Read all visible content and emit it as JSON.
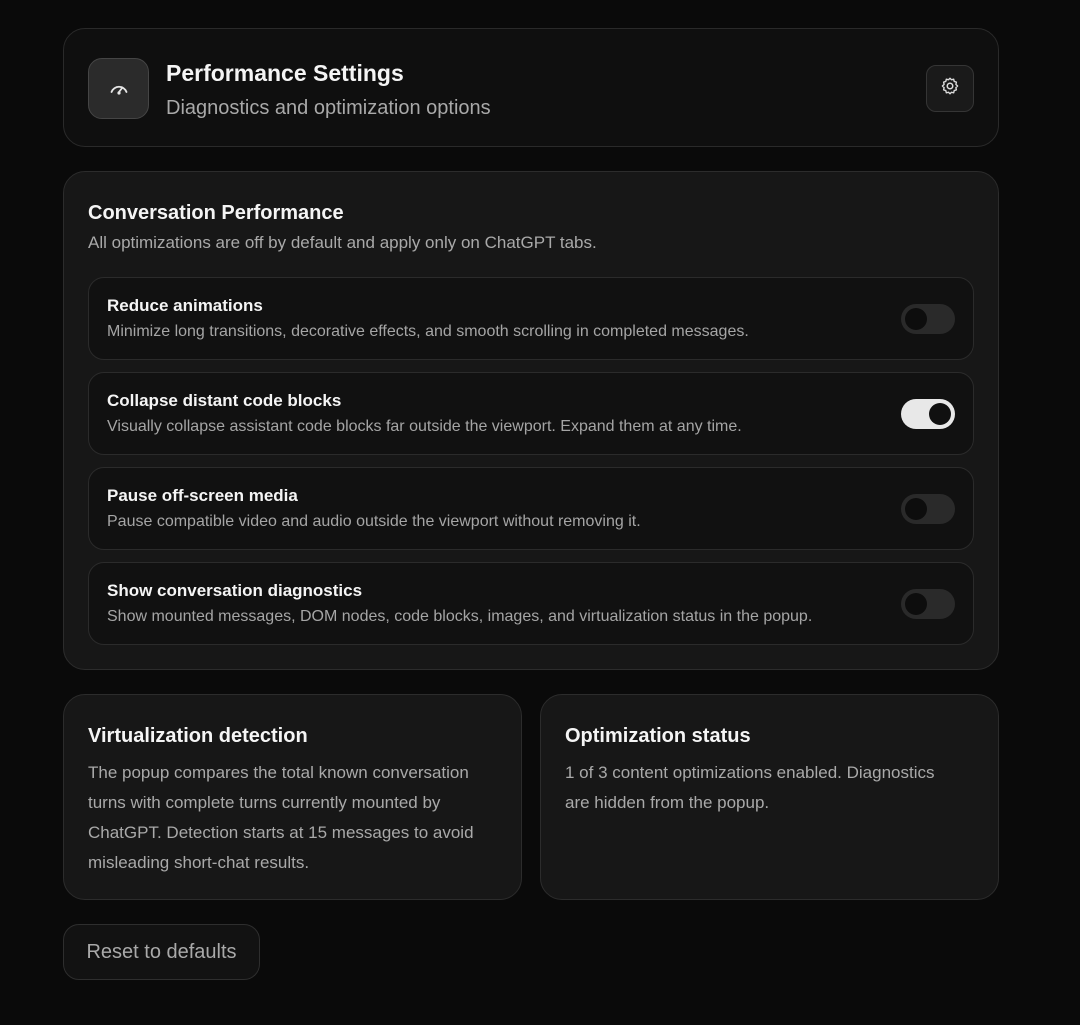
{
  "header": {
    "title": "Performance Settings",
    "subtitle": "Diagnostics and optimization options",
    "app_icon": "gauge-icon",
    "settings_icon": "gear-icon"
  },
  "performance": {
    "title": "Conversation Performance",
    "description": "All optimizations are off by default and apply only on ChatGPT tabs.",
    "options": [
      {
        "label": "Reduce animations",
        "description": "Minimize long transitions, decorative effects, and smooth scrolling in completed messages.",
        "enabled": false
      },
      {
        "label": "Collapse distant code blocks",
        "description": "Visually collapse assistant code blocks far outside the viewport. Expand them at any time.",
        "enabled": true
      },
      {
        "label": "Pause off-screen media",
        "description": "Pause compatible video and audio outside the viewport without removing it.",
        "enabled": false
      },
      {
        "label": "Show conversation diagnostics",
        "description": "Show mounted messages, DOM nodes, code blocks, images, and virtualization status in the popup.",
        "enabled": false
      }
    ]
  },
  "virtualization": {
    "title": "Virtualization detection",
    "lines": [
      "The popup compares the total known conversation",
      "turns with complete turns currently mounted by",
      "ChatGPT. Detection starts at 15 messages to avoid",
      "misleading short-chat results."
    ]
  },
  "status": {
    "title": "Optimization status",
    "lines": [
      "1 of 3 content optimizations enabled. Diagnostics",
      "are hidden from the popup."
    ]
  },
  "reset_label": "Reset to defaults",
  "colors": {
    "background": "#0a0a0a",
    "card": "#171717",
    "toggle_on": "#e8e8e8",
    "toggle_off": "#2a2a2a"
  }
}
